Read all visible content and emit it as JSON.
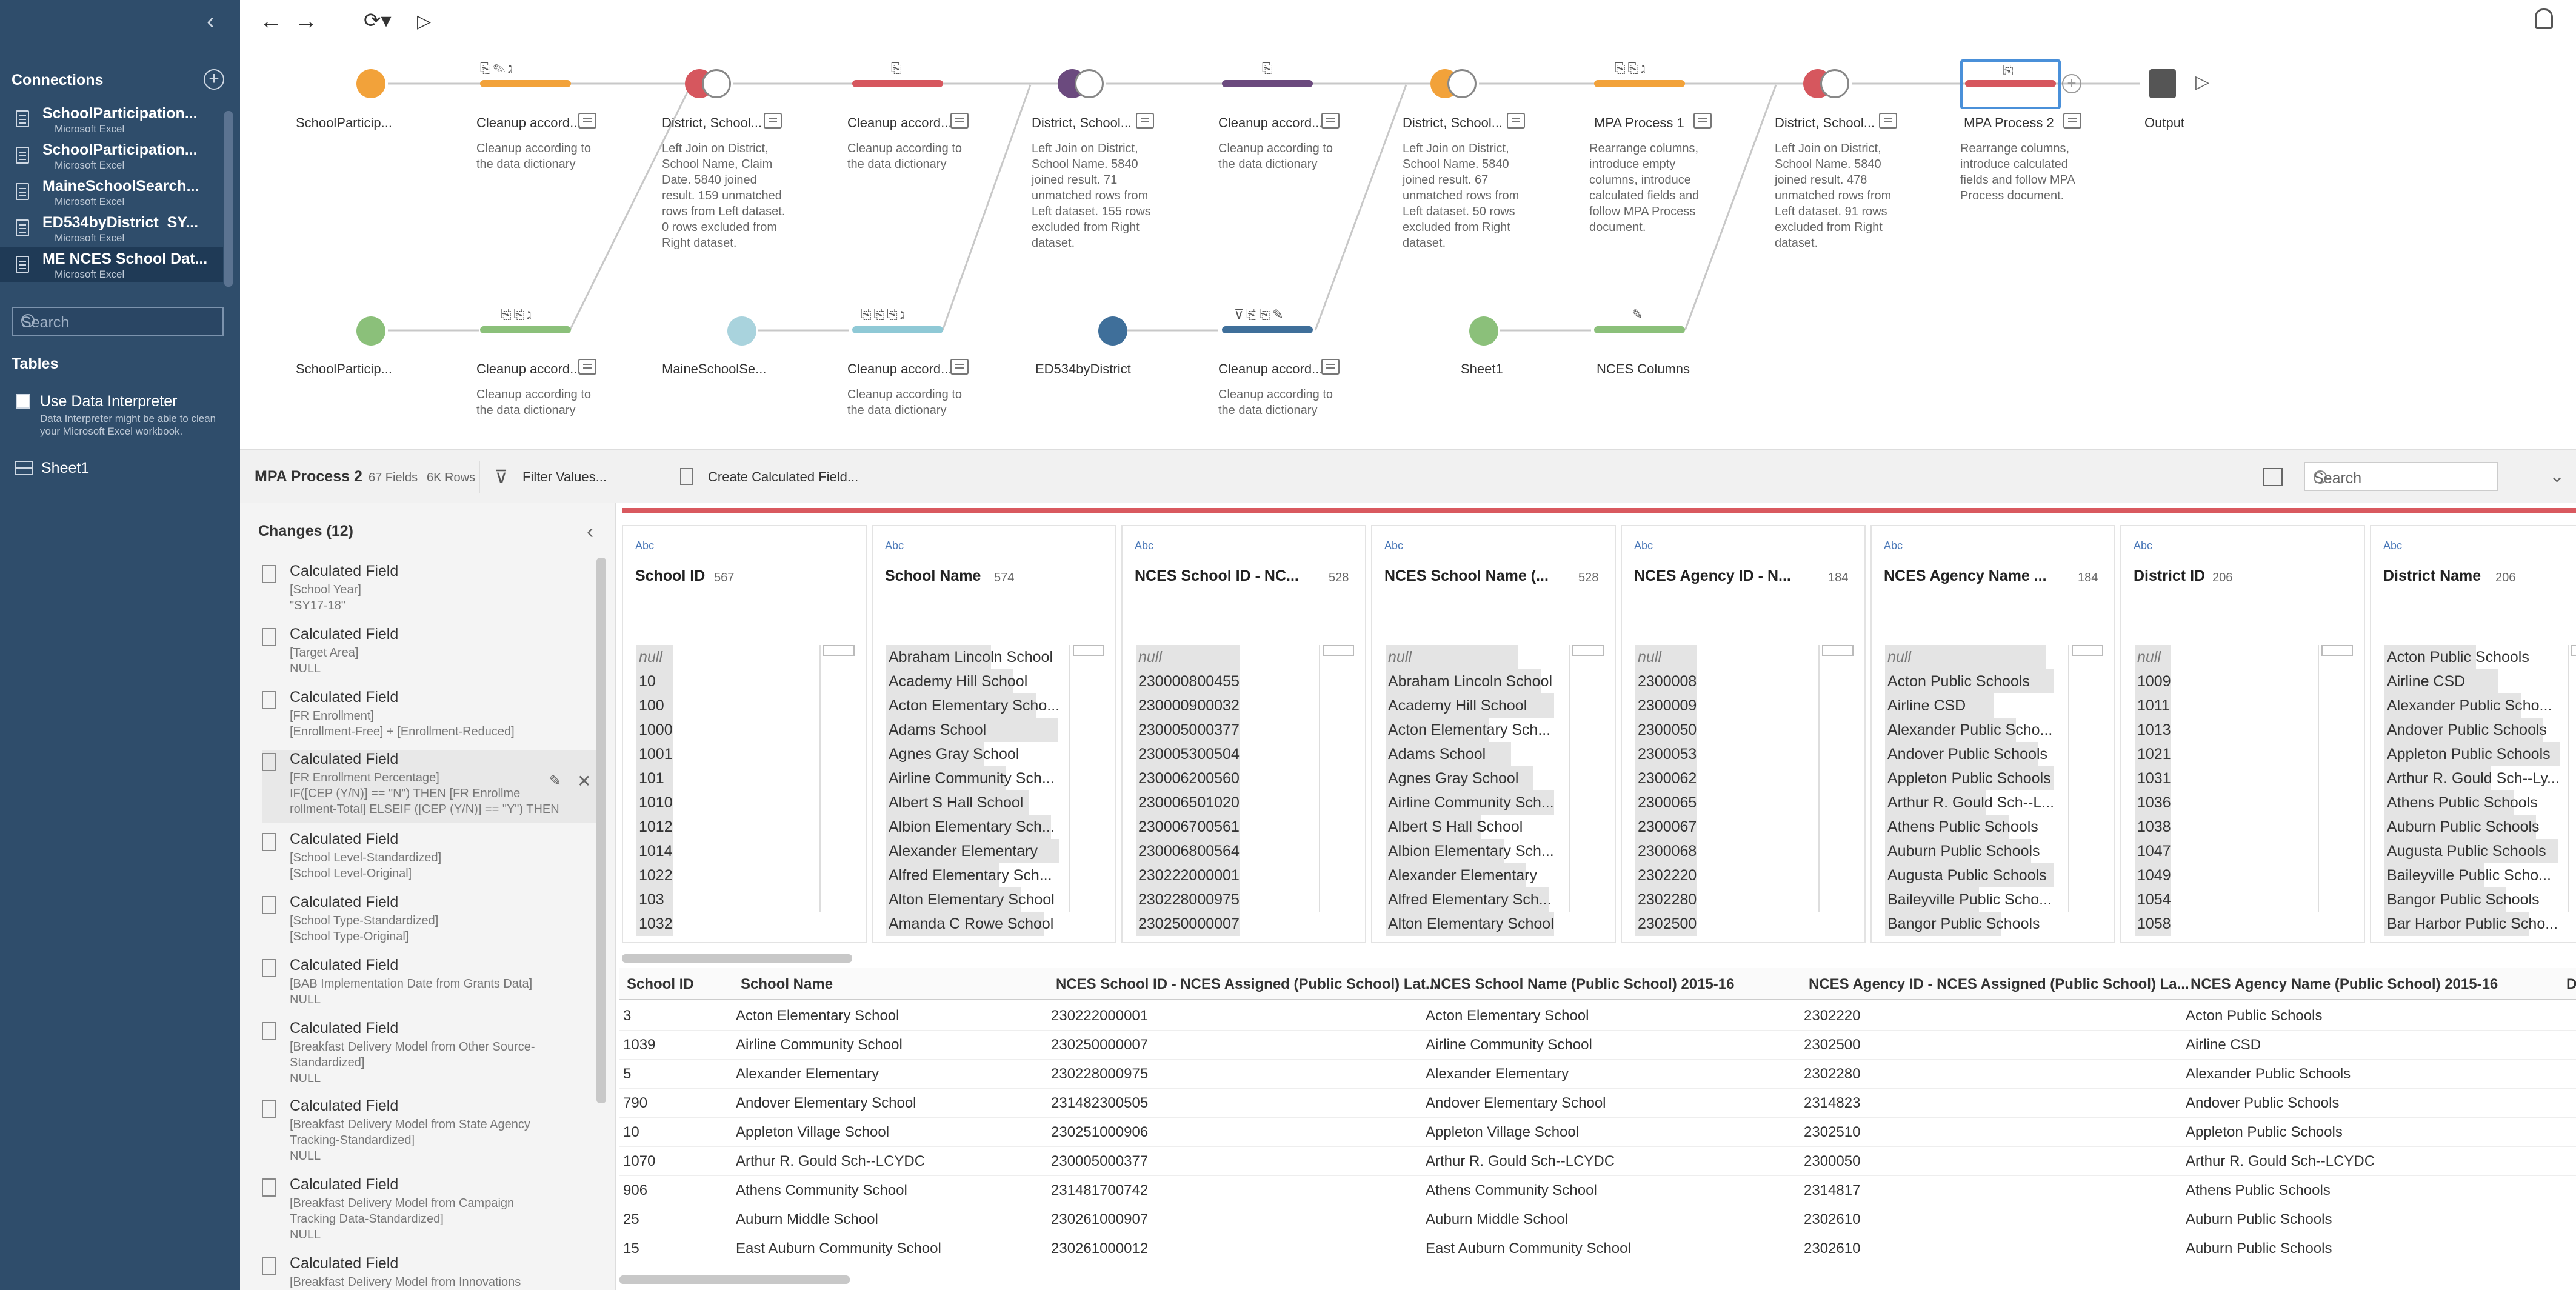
{
  "sidebar": {
    "connections_title": "Connections",
    "connections": [
      {
        "name": "SchoolParticipation...",
        "type": "Microsoft Excel"
      },
      {
        "name": "SchoolParticipation...",
        "type": "Microsoft Excel"
      },
      {
        "name": "MaineSchoolSearch...",
        "type": "Microsoft Excel"
      },
      {
        "name": "ED534byDistrict_SY...",
        "type": "Microsoft Excel"
      },
      {
        "name": "ME NCES School Dat...",
        "type": "Microsoft Excel"
      }
    ],
    "search_placeholder": "Search",
    "tables_title": "Tables",
    "use_interpreter": "Use Data Interpreter",
    "interpreter_note": "Data Interpreter might be able to clean your Microsoft Excel workbook.",
    "sheet": "Sheet1"
  },
  "flow": {
    "top_row": [
      {
        "label": "SchoolParticip...",
        "kind": "input",
        "color": "#f2a23a"
      },
      {
        "label": "Cleanup accord...",
        "kind": "clean",
        "color": "#f2a23a",
        "desc": "Cleanup according to the data dictionary"
      },
      {
        "label": "District, School...",
        "kind": "join",
        "color": "#d6575e",
        "desc": "Left Join on District, School Name, Claim Date. 5840 joined result. 159 unmatched rows from Left dataset. 0 rows excluded from Right dataset."
      },
      {
        "label": "Cleanup accord...",
        "kind": "clean",
        "color": "#d6575e",
        "desc": "Cleanup according to the data dictionary"
      },
      {
        "label": "District, School...",
        "kind": "join",
        "color": "#6b4a7e",
        "desc": "Left Join on District, School Name. 5840 joined result. 71 unmatched rows from Left dataset. 155 rows excluded from Right dataset."
      },
      {
        "label": "Cleanup accord...",
        "kind": "clean",
        "color": "#6b4a7e",
        "desc": "Cleanup according to the data dictionary"
      },
      {
        "label": "District, School...",
        "kind": "join",
        "color": "#f2a23a",
        "desc": "Left Join on District, School Name. 5840 joined result. 67 unmatched rows from Left dataset. 50 rows excluded from Right dataset."
      },
      {
        "label": "MPA Process 1",
        "kind": "clean",
        "color": "#f2a23a",
        "desc": "Rearrange columns, introduce empty columns, introduce calculated fields and follow MPA Process document."
      },
      {
        "label": "District, School...",
        "kind": "join",
        "color": "#d6575e",
        "desc": "Left Join on District, School Name. 5840 joined result. 478 unmatched rows from Left dataset. 91 rows excluded from Right dataset."
      },
      {
        "label": "MPA Process 2",
        "kind": "clean",
        "color": "#d6575e",
        "desc": "Rearrange columns, introduce calculated fields and follow MPA Process document."
      },
      {
        "label": "Output",
        "kind": "output"
      }
    ],
    "bottom_row": [
      {
        "label": "SchoolParticip...",
        "kind": "input",
        "color": "#8bc07a"
      },
      {
        "label": "Cleanup accord...",
        "kind": "clean",
        "color": "#8bc07a",
        "desc": "Cleanup according to the data dictionary"
      },
      {
        "label": "MaineSchoolSe...",
        "kind": "input",
        "color": "#a9d3dd"
      },
      {
        "label": "Cleanup accord...",
        "kind": "clean",
        "color": "#8fc9d6",
        "desc": "Cleanup according to the data dictionary"
      },
      {
        "label": "ED534byDistrict",
        "kind": "input",
        "color": "#3f6f9a"
      },
      {
        "label": "Cleanup accord...",
        "kind": "clean",
        "color": "#3f6f9a",
        "desc": "Cleanup according to the data dictionary"
      },
      {
        "label": "Sheet1",
        "kind": "input",
        "color": "#8bc07a"
      },
      {
        "label": "NCES Columns",
        "kind": "clean",
        "color": "#8bc07a"
      }
    ]
  },
  "profile": {
    "title": "MPA Process 2",
    "fields": "67 Fields",
    "rows": "6K Rows",
    "filter_btn": "Filter Values...",
    "calc_btn": "Create Calculated Field...",
    "search_placeholder": "Search"
  },
  "changes": {
    "title": "Changes (12)",
    "items": [
      {
        "type": "Calculated Field",
        "detail": "[School Year]\n\"SY17-18\""
      },
      {
        "type": "Calculated Field",
        "detail": "[Target Area]\nNULL"
      },
      {
        "type": "Calculated Field",
        "detail": "[FR Enrollment]\n[Enrollment-Free] + [Enrollment-Reduced]"
      },
      {
        "type": "Calculated Field",
        "detail": "[FR Enrollment Percentage]\nIF([CEP (Y/N)] == \"N\") THEN [FR Enrollme\nrollment-Total] ELSEIF ([CEP (Y/N)] == \"Y\") THEN"
      },
      {
        "type": "Calculated Field",
        "detail": "[School Level-Standardized]\n[School Level-Original]"
      },
      {
        "type": "Calculated Field",
        "detail": "[School Type-Standardized]\n[School Type-Original]"
      },
      {
        "type": "Calculated Field",
        "detail": "[BAB Implementation Date from Grants Data]\nNULL"
      },
      {
        "type": "Calculated Field",
        "detail": "[Breakfast Delivery Model from Other Source-\nStandardized]\nNULL"
      },
      {
        "type": "Calculated Field",
        "detail": "[Breakfast Delivery Model from State Agency\nTracking-Standardized]\nNULL"
      },
      {
        "type": "Calculated Field",
        "detail": "[Breakfast Delivery Model from Campaign\nTracking Data-Standardized]\nNULL"
      },
      {
        "type": "Calculated Field",
        "detail": "[Breakfast Delivery Model from Innovations"
      }
    ]
  },
  "cards": [
    {
      "name": "School ID",
      "count": "567",
      "values": [
        "null",
        "10",
        "100",
        "1000",
        "1001",
        "101",
        "1010",
        "1012",
        "1014",
        "1022",
        "103",
        "1032"
      ]
    },
    {
      "name": "School Name",
      "count": "574",
      "values": [
        "Abraham Lincoln School",
        "Academy Hill School",
        "Acton Elementary Scho...",
        "Adams School",
        "Agnes Gray School",
        "Airline Community Sch...",
        "Albert S Hall School",
        "Albion Elementary Sch...",
        "Alexander Elementary",
        "Alfred Elementary Sch...",
        "Alton Elementary School",
        "Amanda C Rowe School"
      ]
    },
    {
      "name": "NCES School ID - NC...",
      "count": "528",
      "values": [
        "null",
        "230000800455",
        "230000900032",
        "230005000377",
        "230005300504",
        "230006200560",
        "230006501020",
        "230006700561",
        "230006800564",
        "230222000001",
        "230228000975",
        "230250000007"
      ]
    },
    {
      "name": "NCES School Name (...",
      "count": "528",
      "values": [
        "null",
        "Abraham Lincoln School",
        "Academy Hill School",
        "Acton Elementary Sch...",
        "Adams School",
        "Agnes Gray School",
        "Airline Community Sch...",
        "Albert S Hall School",
        "Albion Elementary Sch...",
        "Alexander Elementary",
        "Alfred Elementary Sch...",
        "Alton Elementary School"
      ]
    },
    {
      "name": "NCES Agency ID - N...",
      "count": "184",
      "values": [
        "null",
        "2300008",
        "2300009",
        "2300050",
        "2300053",
        "2300062",
        "2300065",
        "2300067",
        "2300068",
        "2302220",
        "2302280",
        "2302500"
      ]
    },
    {
      "name": "NCES Agency Name ...",
      "count": "184",
      "values": [
        "null",
        "Acton Public Schools",
        "Airline CSD",
        "Alexander Public Scho...",
        "Andover Public Schools",
        "Appleton Public Schools",
        "Arthur R. Gould Sch--L...",
        "Athens Public Schools",
        "Auburn Public Schools",
        "Augusta Public Schools",
        "Baileyville Public Scho...",
        "Bangor Public Schools"
      ]
    },
    {
      "name": "District ID",
      "count": "206",
      "values": [
        "null",
        "1009",
        "1011",
        "1013",
        "1021",
        "1031",
        "1036",
        "1038",
        "1047",
        "1049",
        "1054",
        "1058"
      ]
    },
    {
      "name": "District Name",
      "count": "206",
      "values": [
        "Acton Public Schools",
        "Airline CSD",
        "Alexander Public Scho...",
        "Andover Public Schools",
        "Appleton Public Schools",
        "Arthur R. Gould Sch--Ly...",
        "Athens Public Schools",
        "Auburn Public Schools",
        "Augusta Public Schools",
        "Baileyville Public Scho...",
        "Bangor Public Schools",
        "Bar Harbor Public Scho..."
      ]
    }
  ],
  "grid": {
    "headers": [
      "School ID",
      "School Name",
      "NCES School ID - NCES Assigned (Public School) Lat...",
      "NCES School Name (Public School) 2015-16",
      "NCES Agency ID - NCES Assigned (Public School) La...",
      "NCES Agency Name (Public School) 2015-16",
      "D"
    ],
    "rows": [
      [
        "3",
        "Acton Elementary School",
        "230222000001",
        "Acton Elementary School",
        "2302220",
        "Acton Public Schools"
      ],
      [
        "1039",
        "Airline Community School",
        "230250000007",
        "Airline Community School",
        "2302500",
        "Airline CSD"
      ],
      [
        "5",
        "Alexander Elementary",
        "230228000975",
        "Alexander Elementary",
        "2302280",
        "Alexander Public Schools"
      ],
      [
        "790",
        "Andover Elementary School",
        "231482300505",
        "Andover Elementary School",
        "2314823",
        "Andover Public Schools"
      ],
      [
        "10",
        "Appleton Village School",
        "230251000906",
        "Appleton Village School",
        "2302510",
        "Appleton Public Schools"
      ],
      [
        "1070",
        "Arthur R. Gould Sch--LCYDC",
        "230005000377",
        "Arthur R. Gould Sch--LCYDC",
        "2300050",
        "Arthur R. Gould Sch--LCYDC"
      ],
      [
        "906",
        "Athens Community School",
        "231481700742",
        "Athens Community School",
        "2314817",
        "Athens Public Schools"
      ],
      [
        "25",
        "Auburn Middle School",
        "230261000907",
        "Auburn Middle School",
        "2302610",
        "Auburn Public Schools"
      ],
      [
        "15",
        "East Auburn Community School",
        "230261000012",
        "East Auburn Community School",
        "2302610",
        "Auburn Public Schools"
      ]
    ]
  }
}
